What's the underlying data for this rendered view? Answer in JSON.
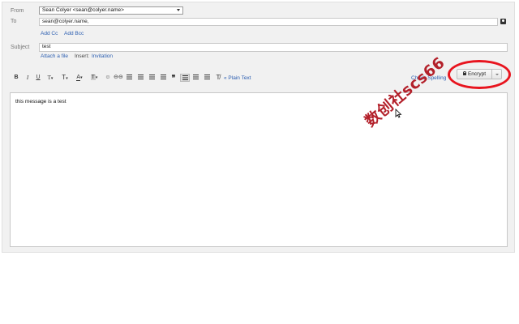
{
  "compose": {
    "from_label": "From",
    "from_value": "Sean Colyer <sean@colyer.name>",
    "to_label": "To",
    "to_value": "sean@colyer.name,",
    "add_cc": "Add Cc",
    "add_bcc": "Add Bcc",
    "subject_label": "Subject",
    "subject_value": "test",
    "attach_file": "Attach a file",
    "insert_label": "Insert:",
    "invitation": "Invitation"
  },
  "toolbar": {
    "bold": "B",
    "italic": "I",
    "underline": "U",
    "font": "T",
    "size": "T",
    "text_color": "A",
    "highlight": "T",
    "plain_text": "« Plain Text",
    "check_spelling": "Check Spelling"
  },
  "encrypt": {
    "label": "Encrypt"
  },
  "editor": {
    "body_text": "this message is a test"
  },
  "watermark": {
    "text": "数创社scs66"
  },
  "colors": {
    "link": "#2a5db0",
    "highlight_ring": "#e8141e",
    "watermark": "#b3202a"
  }
}
